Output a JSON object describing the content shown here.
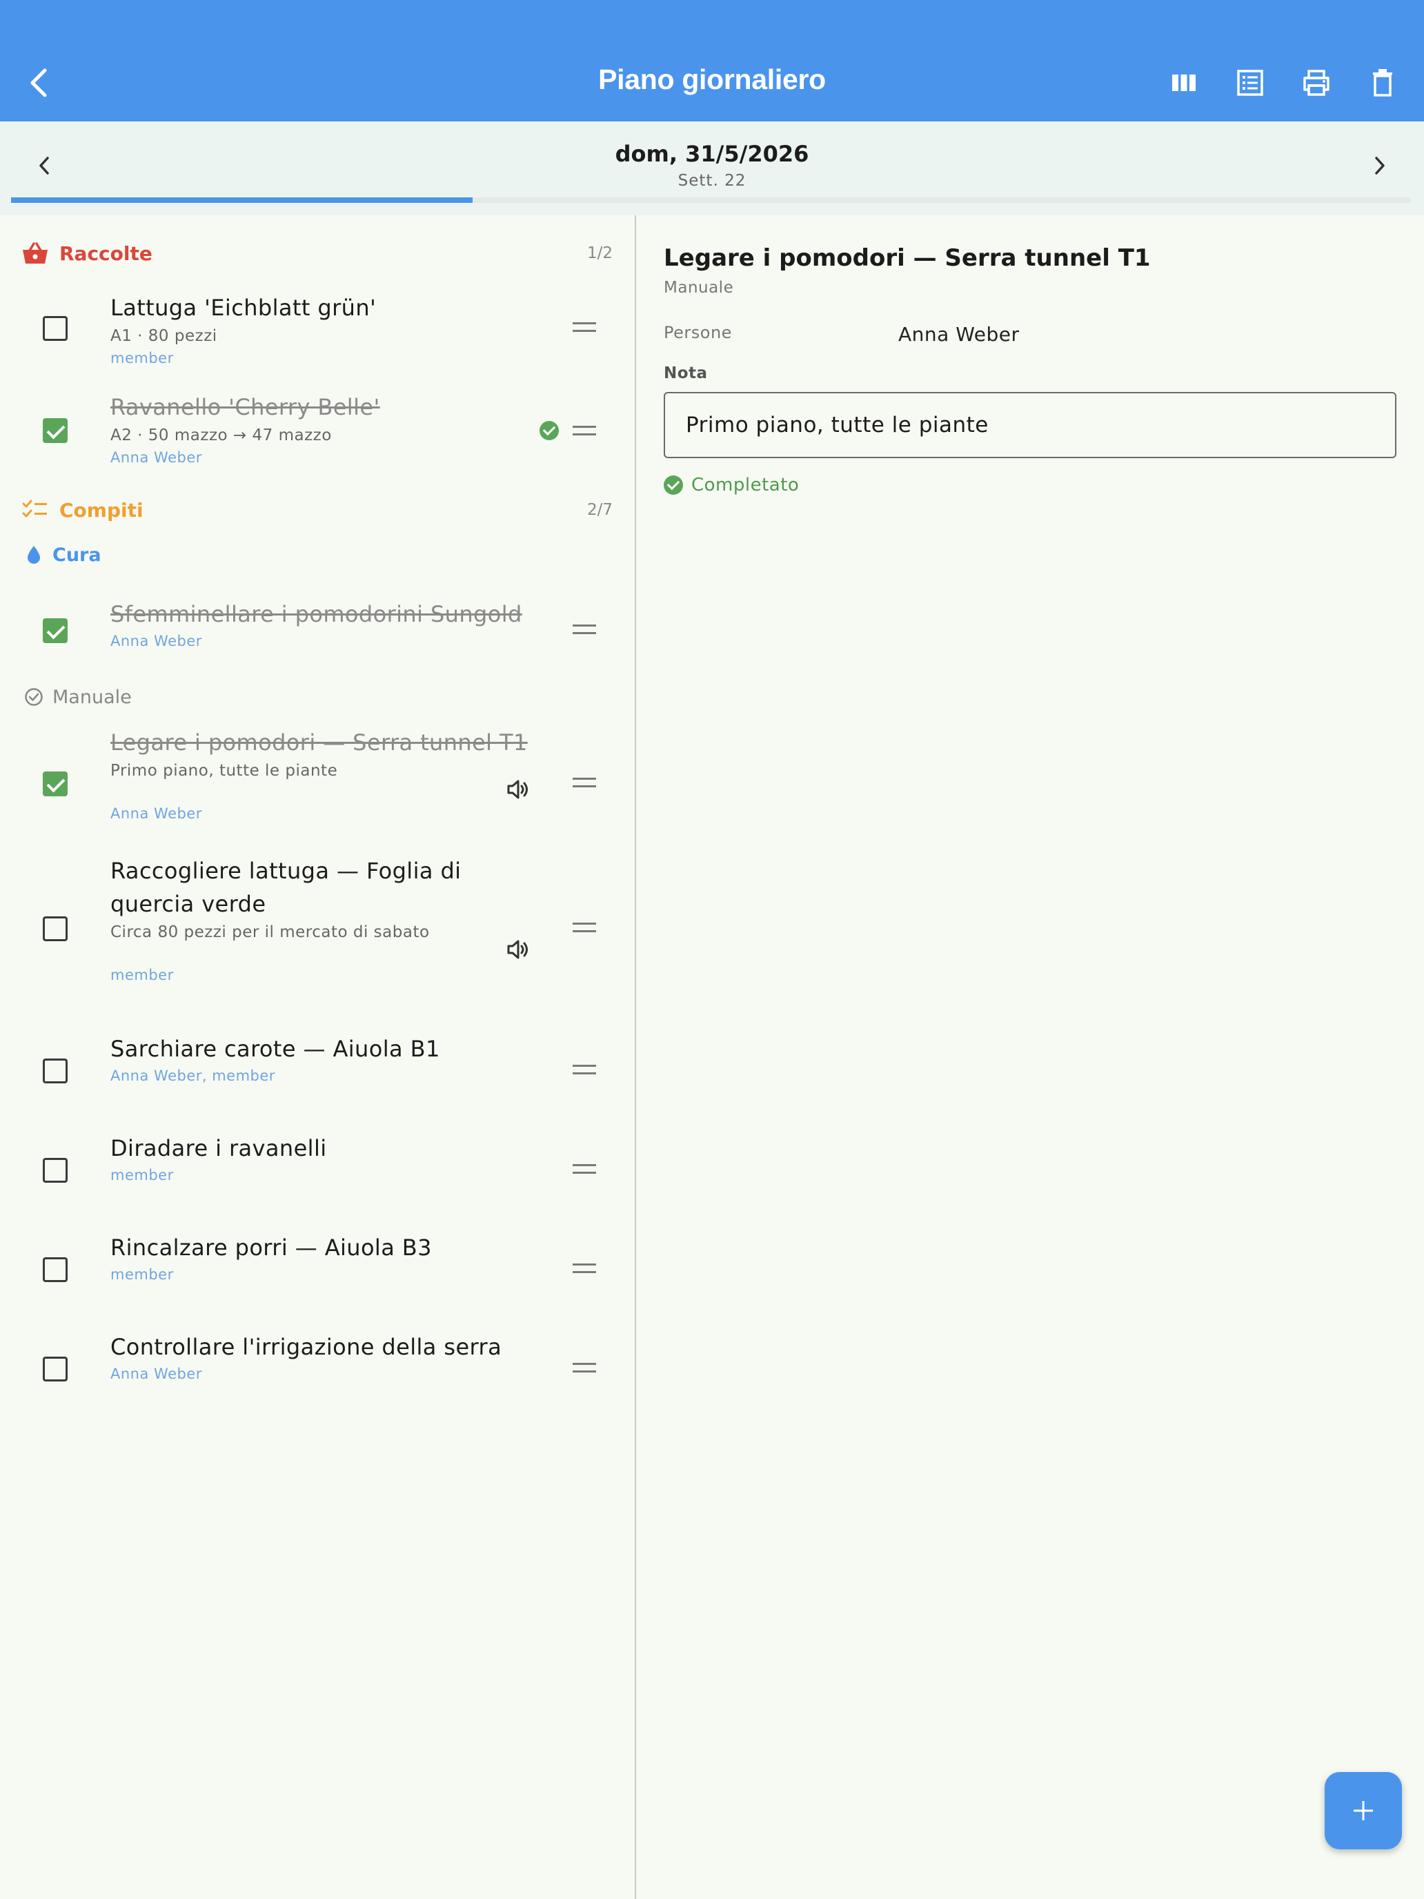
{
  "appbar": {
    "title": "Piano giornaliero",
    "icons": [
      "back-arrow-icon",
      "columns-view-icon",
      "list-view-icon",
      "print-icon",
      "trash-icon"
    ],
    "color": "#4a94ec"
  },
  "datebar": {
    "date": "dom, 31/5/2026",
    "week": "Sett. 22",
    "progress": 0.33
  },
  "sections": {
    "harvests": {
      "title": "Raccolte",
      "count": "1/2",
      "color": "#d9473b",
      "icon": "basket-icon"
    },
    "tasks": {
      "title": "Compiti",
      "count": "2/7",
      "color": "#f0a030",
      "icon": "checklist-icon"
    },
    "care": {
      "title": "Cura",
      "color": "#4a94ec",
      "icon": "water-drop-icon"
    },
    "manual": {
      "title": "Manuale",
      "color": "#888888",
      "icon": "check-circle-icon"
    }
  },
  "harvest_items": [
    {
      "title": "Lattuga 'Eichblatt grün'",
      "sub": "A1 · 80 pezzi",
      "who": "member",
      "checked": false
    },
    {
      "title": "Ravanello 'Cherry Belle'",
      "sub": "A2 · 50 mazzo → 47 mazzo",
      "who": "Anna Weber",
      "checked": true
    }
  ],
  "care_items": [
    {
      "title": "Sfemminellare i pomodorini Sungold",
      "who": "Anna Weber",
      "checked": true
    }
  ],
  "manual_items": [
    {
      "title": "Legare i pomodori — Serra tunnel T1",
      "sub": "Primo piano, tutte le piante",
      "who": "Anna Weber",
      "checked": true
    },
    {
      "title": "Raccogliere lattuga — Foglia di quercia verde",
      "sub": "Circa 80 pezzi per il mercato di sabato",
      "who": "member",
      "checked": false
    },
    {
      "title": "Sarchiare carote — Aiuola B1",
      "who": "Anna Weber, member",
      "checked": false
    },
    {
      "title": "Diradare i ravanelli",
      "who": "member",
      "checked": false
    },
    {
      "title": "Rincalzare porri — Aiuola B3",
      "who": "member",
      "checked": false
    },
    {
      "title": "Controllare l'irrigazione della serra",
      "who": "Anna Weber",
      "checked": false
    }
  ],
  "detail": {
    "title": "Legare i pomodori — Serra tunnel T1",
    "category": "Manuale",
    "persons_label": "Persone",
    "persons_value": "Anna Weber",
    "note_label": "Nota",
    "note_value": "Primo piano, tutte le piante",
    "status": "Completato"
  },
  "fab": {
    "icon": "plus-icon"
  }
}
